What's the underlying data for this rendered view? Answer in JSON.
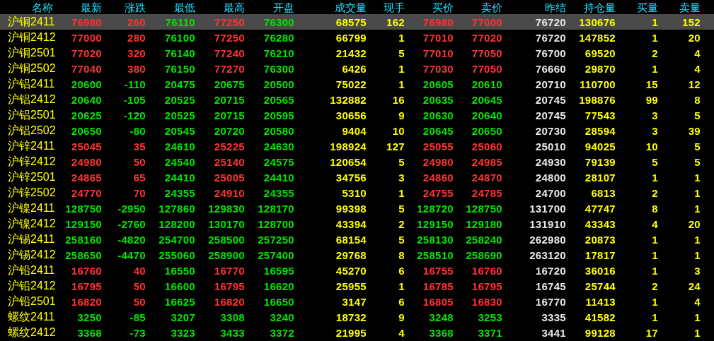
{
  "columns": [
    {
      "label": "名称",
      "kind": "name"
    },
    {
      "label": "最新",
      "kind": "price"
    },
    {
      "label": "涨跌",
      "kind": "price"
    },
    {
      "label": "最低",
      "kind": "price"
    },
    {
      "label": "最高",
      "kind": "price"
    },
    {
      "label": "开盘",
      "kind": "price"
    },
    {
      "label": "成交量",
      "kind": "volume"
    },
    {
      "label": "现手",
      "kind": "volume"
    },
    {
      "label": "买价",
      "kind": "price"
    },
    {
      "label": "卖价",
      "kind": "price"
    },
    {
      "label": "昨结",
      "kind": "prev"
    },
    {
      "label": "持仓量",
      "kind": "volume"
    },
    {
      "label": "买量",
      "kind": "volume"
    },
    {
      "label": "卖量",
      "kind": "volume"
    }
  ],
  "rows": [
    {
      "selected": true,
      "cells": [
        {
          "text": "沪铜2411"
        },
        {
          "text": "76980",
          "color": "#ff3333"
        },
        {
          "text": "260",
          "color": "#ff3333"
        },
        {
          "text": "76110",
          "color": "#00e600"
        },
        {
          "text": "77250",
          "color": "#ff3333"
        },
        {
          "text": "76300",
          "color": "#00e600"
        },
        {
          "text": "68575"
        },
        {
          "text": "162"
        },
        {
          "text": "76980",
          "color": "#ff3333"
        },
        {
          "text": "77000",
          "color": "#ff3333"
        },
        {
          "text": "76720"
        },
        {
          "text": "130676"
        },
        {
          "text": "1"
        },
        {
          "text": "152"
        }
      ]
    },
    {
      "selected": false,
      "cells": [
        {
          "text": "沪铜2412"
        },
        {
          "text": "77000",
          "color": "#ff3333"
        },
        {
          "text": "280",
          "color": "#ff3333"
        },
        {
          "text": "76100",
          "color": "#00e600"
        },
        {
          "text": "77250",
          "color": "#ff3333"
        },
        {
          "text": "76280",
          "color": "#00e600"
        },
        {
          "text": "66799"
        },
        {
          "text": "1"
        },
        {
          "text": "77010",
          "color": "#ff3333"
        },
        {
          "text": "77020",
          "color": "#ff3333"
        },
        {
          "text": "76720"
        },
        {
          "text": "147852"
        },
        {
          "text": "1"
        },
        {
          "text": "20"
        }
      ]
    },
    {
      "selected": false,
      "cells": [
        {
          "text": "沪铜2501"
        },
        {
          "text": "77020",
          "color": "#ff3333"
        },
        {
          "text": "320",
          "color": "#ff3333"
        },
        {
          "text": "76140",
          "color": "#00e600"
        },
        {
          "text": "77240",
          "color": "#ff3333"
        },
        {
          "text": "76210",
          "color": "#00e600"
        },
        {
          "text": "21432"
        },
        {
          "text": "5"
        },
        {
          "text": "77010",
          "color": "#ff3333"
        },
        {
          "text": "77050",
          "color": "#ff3333"
        },
        {
          "text": "76700"
        },
        {
          "text": "69520"
        },
        {
          "text": "2"
        },
        {
          "text": "4"
        }
      ]
    },
    {
      "selected": false,
      "cells": [
        {
          "text": "沪铜2502"
        },
        {
          "text": "77040",
          "color": "#ff3333"
        },
        {
          "text": "380",
          "color": "#ff3333"
        },
        {
          "text": "76150",
          "color": "#00e600"
        },
        {
          "text": "77270",
          "color": "#ff3333"
        },
        {
          "text": "76300",
          "color": "#00e600"
        },
        {
          "text": "6426"
        },
        {
          "text": "1"
        },
        {
          "text": "77030",
          "color": "#ff3333"
        },
        {
          "text": "77050",
          "color": "#ff3333"
        },
        {
          "text": "76660"
        },
        {
          "text": "29870"
        },
        {
          "text": "1"
        },
        {
          "text": "4"
        }
      ]
    },
    {
      "selected": false,
      "cells": [
        {
          "text": "沪铝2411"
        },
        {
          "text": "20600",
          "color": "#00e600"
        },
        {
          "text": "-110",
          "color": "#00e600"
        },
        {
          "text": "20475",
          "color": "#00e600"
        },
        {
          "text": "20675",
          "color": "#00e600"
        },
        {
          "text": "20500",
          "color": "#00e600"
        },
        {
          "text": "75022"
        },
        {
          "text": "1"
        },
        {
          "text": "20605",
          "color": "#00e600"
        },
        {
          "text": "20610",
          "color": "#00e600"
        },
        {
          "text": "20710"
        },
        {
          "text": "110700"
        },
        {
          "text": "15"
        },
        {
          "text": "12"
        }
      ]
    },
    {
      "selected": false,
      "cells": [
        {
          "text": "沪铝2412"
        },
        {
          "text": "20640",
          "color": "#00e600"
        },
        {
          "text": "-105",
          "color": "#00e600"
        },
        {
          "text": "20525",
          "color": "#00e600"
        },
        {
          "text": "20715",
          "color": "#00e600"
        },
        {
          "text": "20565",
          "color": "#00e600"
        },
        {
          "text": "132882"
        },
        {
          "text": "16"
        },
        {
          "text": "20635",
          "color": "#00e600"
        },
        {
          "text": "20645",
          "color": "#00e600"
        },
        {
          "text": "20745"
        },
        {
          "text": "198876"
        },
        {
          "text": "99"
        },
        {
          "text": "8"
        }
      ]
    },
    {
      "selected": false,
      "cells": [
        {
          "text": "沪铝2501"
        },
        {
          "text": "20625",
          "color": "#00e600"
        },
        {
          "text": "-120",
          "color": "#00e600"
        },
        {
          "text": "20525",
          "color": "#00e600"
        },
        {
          "text": "20715",
          "color": "#00e600"
        },
        {
          "text": "20595",
          "color": "#00e600"
        },
        {
          "text": "30656"
        },
        {
          "text": "9"
        },
        {
          "text": "20630",
          "color": "#00e600"
        },
        {
          "text": "20640",
          "color": "#00e600"
        },
        {
          "text": "20745"
        },
        {
          "text": "77543"
        },
        {
          "text": "3"
        },
        {
          "text": "5"
        }
      ]
    },
    {
      "selected": false,
      "cells": [
        {
          "text": "沪铝2502"
        },
        {
          "text": "20650",
          "color": "#00e600"
        },
        {
          "text": "-80",
          "color": "#00e600"
        },
        {
          "text": "20545",
          "color": "#00e600"
        },
        {
          "text": "20720",
          "color": "#00e600"
        },
        {
          "text": "20580",
          "color": "#00e600"
        },
        {
          "text": "9404"
        },
        {
          "text": "10"
        },
        {
          "text": "20645",
          "color": "#00e600"
        },
        {
          "text": "20650",
          "color": "#00e600"
        },
        {
          "text": "20730"
        },
        {
          "text": "28594"
        },
        {
          "text": "3"
        },
        {
          "text": "39"
        }
      ]
    },
    {
      "selected": false,
      "cells": [
        {
          "text": "沪锌2411"
        },
        {
          "text": "25045",
          "color": "#ff3333"
        },
        {
          "text": "35",
          "color": "#ff3333"
        },
        {
          "text": "24610",
          "color": "#00e600"
        },
        {
          "text": "25225",
          "color": "#ff3333"
        },
        {
          "text": "24630",
          "color": "#00e600"
        },
        {
          "text": "198924"
        },
        {
          "text": "127"
        },
        {
          "text": "25055",
          "color": "#ff3333"
        },
        {
          "text": "25060",
          "color": "#ff3333"
        },
        {
          "text": "25010"
        },
        {
          "text": "94025"
        },
        {
          "text": "10"
        },
        {
          "text": "5"
        }
      ]
    },
    {
      "selected": false,
      "cells": [
        {
          "text": "沪锌2412"
        },
        {
          "text": "24980",
          "color": "#ff3333"
        },
        {
          "text": "50",
          "color": "#ff3333"
        },
        {
          "text": "24540",
          "color": "#00e600"
        },
        {
          "text": "25140",
          "color": "#ff3333"
        },
        {
          "text": "24575",
          "color": "#00e600"
        },
        {
          "text": "120654"
        },
        {
          "text": "5"
        },
        {
          "text": "24980",
          "color": "#ff3333"
        },
        {
          "text": "24985",
          "color": "#ff3333"
        },
        {
          "text": "24930"
        },
        {
          "text": "79139"
        },
        {
          "text": "5"
        },
        {
          "text": "5"
        }
      ]
    },
    {
      "selected": false,
      "cells": [
        {
          "text": "沪锌2501"
        },
        {
          "text": "24865",
          "color": "#ff3333"
        },
        {
          "text": "65",
          "color": "#ff3333"
        },
        {
          "text": "24410",
          "color": "#00e600"
        },
        {
          "text": "25005",
          "color": "#ff3333"
        },
        {
          "text": "24410",
          "color": "#00e600"
        },
        {
          "text": "34756"
        },
        {
          "text": "3"
        },
        {
          "text": "24860",
          "color": "#ff3333"
        },
        {
          "text": "24870",
          "color": "#ff3333"
        },
        {
          "text": "24800"
        },
        {
          "text": "28107"
        },
        {
          "text": "1"
        },
        {
          "text": "1"
        }
      ]
    },
    {
      "selected": false,
      "cells": [
        {
          "text": "沪锌2502"
        },
        {
          "text": "24770",
          "color": "#ff3333"
        },
        {
          "text": "70",
          "color": "#ff3333"
        },
        {
          "text": "24355",
          "color": "#00e600"
        },
        {
          "text": "24910",
          "color": "#ff3333"
        },
        {
          "text": "24355",
          "color": "#00e600"
        },
        {
          "text": "5310"
        },
        {
          "text": "1"
        },
        {
          "text": "24755",
          "color": "#ff3333"
        },
        {
          "text": "24785",
          "color": "#ff3333"
        },
        {
          "text": "24700"
        },
        {
          "text": "6813"
        },
        {
          "text": "2"
        },
        {
          "text": "1"
        }
      ]
    },
    {
      "selected": false,
      "cells": [
        {
          "text": "沪镍2411"
        },
        {
          "text": "128750",
          "color": "#00e600"
        },
        {
          "text": "-2950",
          "color": "#00e600"
        },
        {
          "text": "127860",
          "color": "#00e600"
        },
        {
          "text": "129830",
          "color": "#00e600"
        },
        {
          "text": "128170",
          "color": "#00e600"
        },
        {
          "text": "99398"
        },
        {
          "text": "5"
        },
        {
          "text": "128720",
          "color": "#00e600"
        },
        {
          "text": "128750",
          "color": "#00e600"
        },
        {
          "text": "131700"
        },
        {
          "text": "47747"
        },
        {
          "text": "8"
        },
        {
          "text": "1"
        }
      ]
    },
    {
      "selected": false,
      "cells": [
        {
          "text": "沪镍2412"
        },
        {
          "text": "129150",
          "color": "#00e600"
        },
        {
          "text": "-2760",
          "color": "#00e600"
        },
        {
          "text": "128200",
          "color": "#00e600"
        },
        {
          "text": "130170",
          "color": "#00e600"
        },
        {
          "text": "128700",
          "color": "#00e600"
        },
        {
          "text": "43394"
        },
        {
          "text": "2"
        },
        {
          "text": "129150",
          "color": "#00e600"
        },
        {
          "text": "129180",
          "color": "#00e600"
        },
        {
          "text": "131910"
        },
        {
          "text": "43343"
        },
        {
          "text": "4"
        },
        {
          "text": "20"
        }
      ]
    },
    {
      "selected": false,
      "cells": [
        {
          "text": "沪锡2411"
        },
        {
          "text": "258160",
          "color": "#00e600"
        },
        {
          "text": "-4820",
          "color": "#00e600"
        },
        {
          "text": "254700",
          "color": "#00e600"
        },
        {
          "text": "258500",
          "color": "#00e600"
        },
        {
          "text": "257250",
          "color": "#00e600"
        },
        {
          "text": "68154"
        },
        {
          "text": "5"
        },
        {
          "text": "258130",
          "color": "#00e600"
        },
        {
          "text": "258240",
          "color": "#00e600"
        },
        {
          "text": "262980"
        },
        {
          "text": "20873"
        },
        {
          "text": "1"
        },
        {
          "text": "1"
        }
      ]
    },
    {
      "selected": false,
      "cells": [
        {
          "text": "沪锡2412"
        },
        {
          "text": "258650",
          "color": "#00e600"
        },
        {
          "text": "-4470",
          "color": "#00e600"
        },
        {
          "text": "255060",
          "color": "#00e600"
        },
        {
          "text": "258900",
          "color": "#00e600"
        },
        {
          "text": "257400",
          "color": "#00e600"
        },
        {
          "text": "29768"
        },
        {
          "text": "8"
        },
        {
          "text": "258510",
          "color": "#00e600"
        },
        {
          "text": "258690",
          "color": "#00e600"
        },
        {
          "text": "263120"
        },
        {
          "text": "17817"
        },
        {
          "text": "1"
        },
        {
          "text": "1"
        }
      ]
    },
    {
      "selected": false,
      "cells": [
        {
          "text": "沪铅2411"
        },
        {
          "text": "16760",
          "color": "#ff3333"
        },
        {
          "text": "40",
          "color": "#ff3333"
        },
        {
          "text": "16550",
          "color": "#00e600"
        },
        {
          "text": "16770",
          "color": "#ff3333"
        },
        {
          "text": "16595",
          "color": "#00e600"
        },
        {
          "text": "45270"
        },
        {
          "text": "6"
        },
        {
          "text": "16755",
          "color": "#ff3333"
        },
        {
          "text": "16760",
          "color": "#ff3333"
        },
        {
          "text": "16720"
        },
        {
          "text": "36016"
        },
        {
          "text": "1"
        },
        {
          "text": "3"
        }
      ]
    },
    {
      "selected": false,
      "cells": [
        {
          "text": "沪铅2412"
        },
        {
          "text": "16795",
          "color": "#ff3333"
        },
        {
          "text": "50",
          "color": "#ff3333"
        },
        {
          "text": "16600",
          "color": "#00e600"
        },
        {
          "text": "16795",
          "color": "#ff3333"
        },
        {
          "text": "16620",
          "color": "#00e600"
        },
        {
          "text": "25955"
        },
        {
          "text": "1"
        },
        {
          "text": "16785",
          "color": "#ff3333"
        },
        {
          "text": "16795",
          "color": "#ff3333"
        },
        {
          "text": "16745"
        },
        {
          "text": "25744"
        },
        {
          "text": "2"
        },
        {
          "text": "24"
        }
      ]
    },
    {
      "selected": false,
      "cells": [
        {
          "text": "沪铅2501"
        },
        {
          "text": "16820",
          "color": "#ff3333"
        },
        {
          "text": "50",
          "color": "#ff3333"
        },
        {
          "text": "16625",
          "color": "#00e600"
        },
        {
          "text": "16820",
          "color": "#ff3333"
        },
        {
          "text": "16650",
          "color": "#00e600"
        },
        {
          "text": "3147"
        },
        {
          "text": "6"
        },
        {
          "text": "16805",
          "color": "#ff3333"
        },
        {
          "text": "16830",
          "color": "#ff3333"
        },
        {
          "text": "16770"
        },
        {
          "text": "11413"
        },
        {
          "text": "1"
        },
        {
          "text": "4"
        }
      ]
    },
    {
      "selected": false,
      "cells": [
        {
          "text": "螺纹2411"
        },
        {
          "text": "3250",
          "color": "#00e600"
        },
        {
          "text": "-85",
          "color": "#00e600"
        },
        {
          "text": "3207",
          "color": "#00e600"
        },
        {
          "text": "3308",
          "color": "#00e600"
        },
        {
          "text": "3240",
          "color": "#00e600"
        },
        {
          "text": "18732"
        },
        {
          "text": "9"
        },
        {
          "text": "3248",
          "color": "#00e600"
        },
        {
          "text": "3253",
          "color": "#00e600"
        },
        {
          "text": "3335"
        },
        {
          "text": "41582"
        },
        {
          "text": "1"
        },
        {
          "text": "1"
        }
      ]
    },
    {
      "selected": false,
      "cells": [
        {
          "text": "螺纹2412"
        },
        {
          "text": "3368",
          "color": "#00e600"
        },
        {
          "text": "-73",
          "color": "#00e600"
        },
        {
          "text": "3323",
          "color": "#00e600"
        },
        {
          "text": "3433",
          "color": "#00e600"
        },
        {
          "text": "3372",
          "color": "#00e600"
        },
        {
          "text": "21995"
        },
        {
          "text": "4"
        },
        {
          "text": "3368",
          "color": "#00e600"
        },
        {
          "text": "3371",
          "color": "#00e600"
        },
        {
          "text": "3441"
        },
        {
          "text": "99128"
        },
        {
          "text": "17"
        },
        {
          "text": "1"
        }
      ]
    }
  ]
}
